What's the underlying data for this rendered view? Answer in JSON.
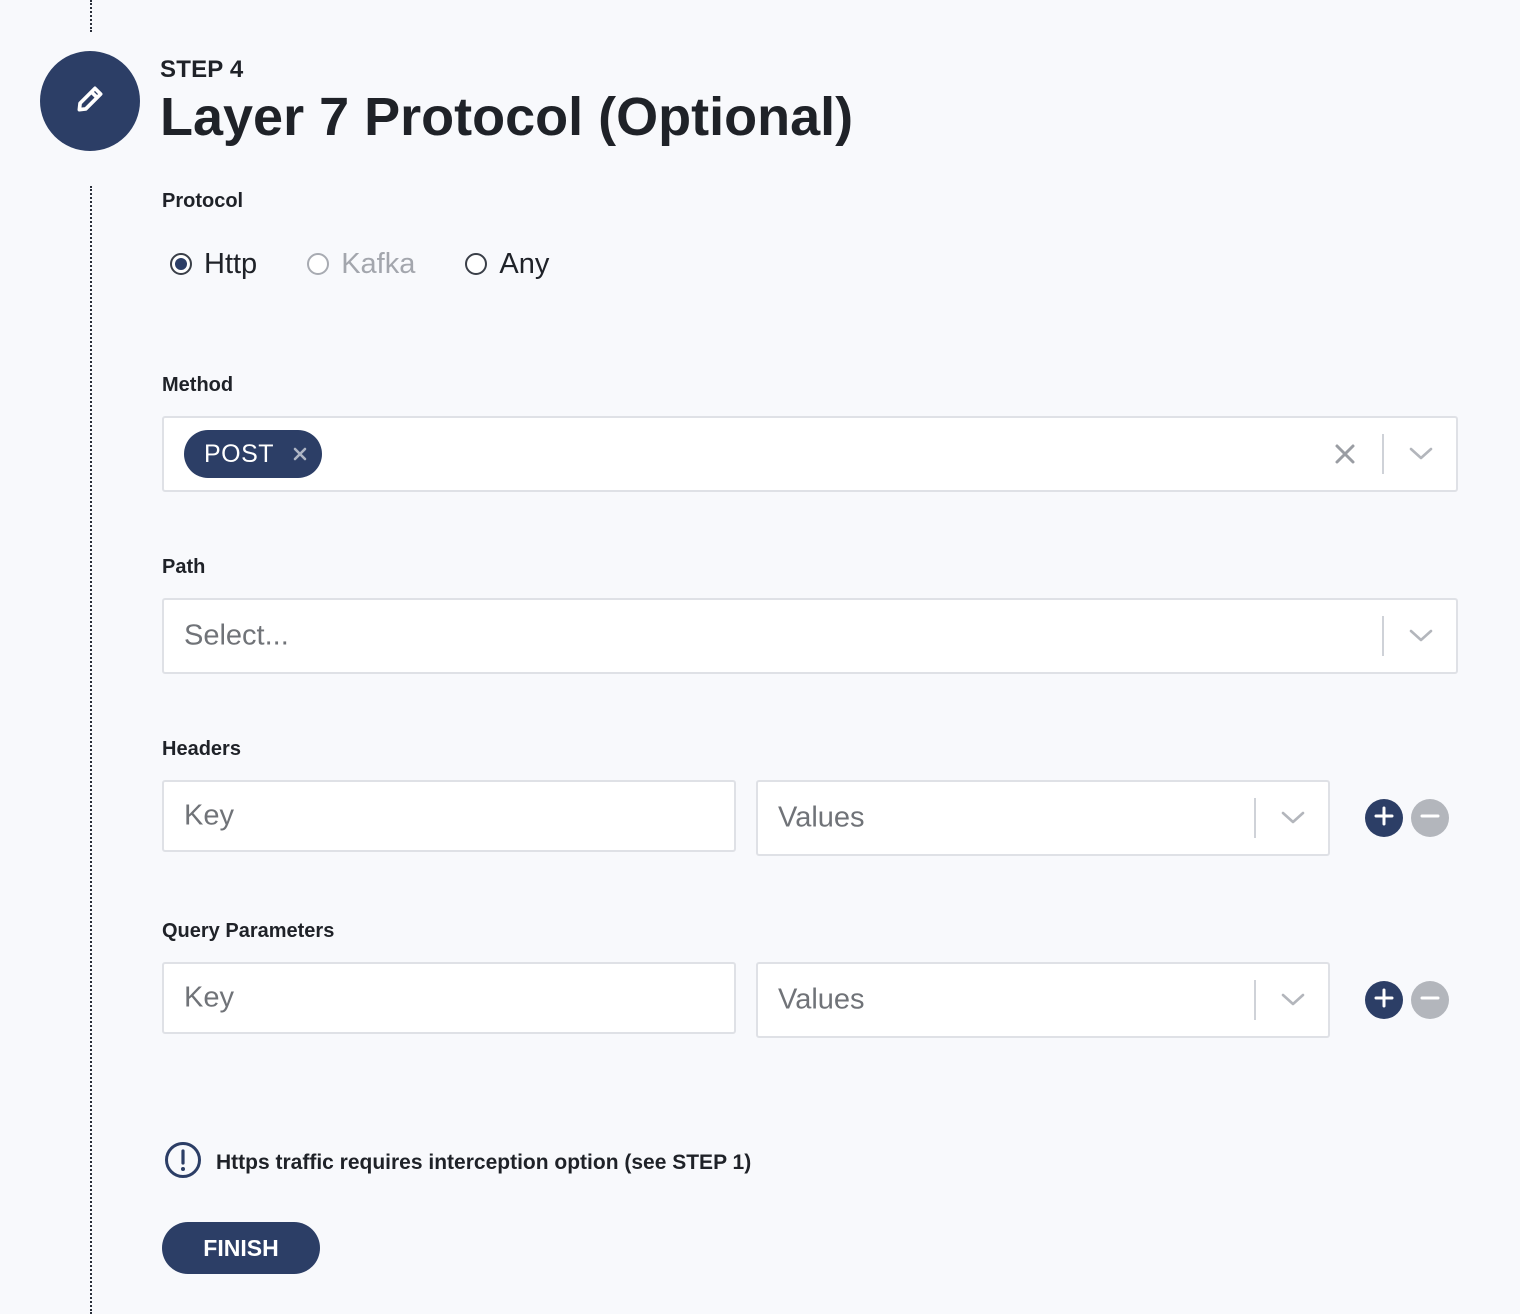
{
  "step": {
    "label": "STEP 4",
    "title": "Layer 7 Protocol (Optional)",
    "icon": "pencil-icon"
  },
  "protocol": {
    "label": "Protocol",
    "options": [
      {
        "label": "Http",
        "selected": true,
        "disabled": false
      },
      {
        "label": "Kafka",
        "selected": false,
        "disabled": true
      },
      {
        "label": "Any",
        "selected": false,
        "disabled": false
      }
    ]
  },
  "method": {
    "label": "Method",
    "selected_chips": [
      "POST"
    ]
  },
  "path": {
    "label": "Path",
    "placeholder": "Select..."
  },
  "headers": {
    "label": "Headers",
    "key_placeholder": "Key",
    "values_placeholder": "Values"
  },
  "query_parameters": {
    "label": "Query Parameters",
    "key_placeholder": "Key",
    "values_placeholder": "Values"
  },
  "notice": {
    "text": "Https traffic requires interception option (see STEP 1)",
    "icon": "alert-icon"
  },
  "finish_button": {
    "label": "FINISH"
  },
  "colors": {
    "primary": "#2c3e66",
    "background": "#f8f9fc",
    "disabled_button": "#b3b6bc"
  }
}
